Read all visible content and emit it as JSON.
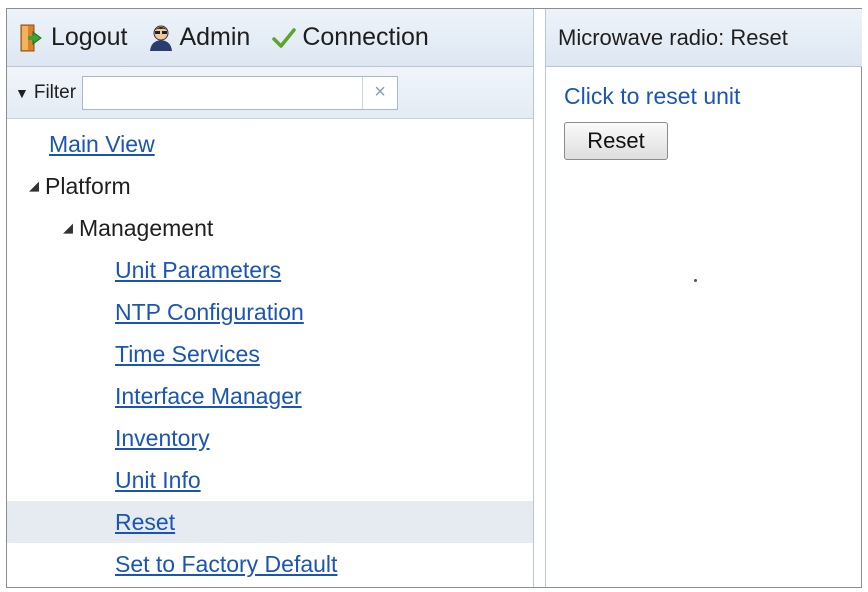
{
  "toolbar": {
    "logout_label": "Logout",
    "admin_label": "Admin",
    "connection_label": "Connection"
  },
  "filter": {
    "label": "Filter",
    "value": "",
    "clear_glyph": "×"
  },
  "nav": {
    "main_view": "Main View",
    "platform": "Platform",
    "management": "Management",
    "items": [
      "Unit Parameters",
      "NTP Configuration",
      "Time Services",
      "Interface Manager",
      "Inventory",
      "Unit Info",
      "Reset",
      "Set to Factory Default"
    ],
    "selected": "Reset"
  },
  "content": {
    "title": "Microwave radio: Reset",
    "caption": "Click to reset unit",
    "reset_button": "Reset"
  },
  "icons": {
    "logout": "logout-door-icon",
    "admin": "admin-user-icon",
    "connection": "check-icon"
  },
  "colors": {
    "link": "#1a55b5",
    "header_bg": "#dde7f2",
    "selected_row": "#e6ebf1",
    "check": "#5aa62a"
  }
}
